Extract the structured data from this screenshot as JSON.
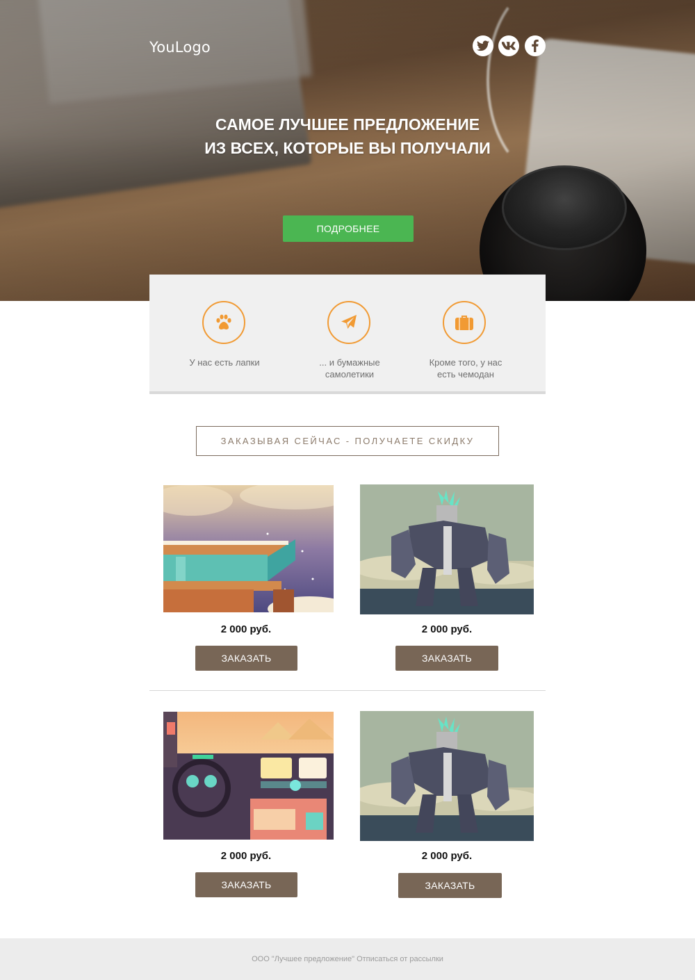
{
  "header": {
    "logo": "YouLogo",
    "social": [
      "twitter-icon",
      "vk-icon",
      "facebook-icon"
    ],
    "headline_line1": "САМОЕ ЛУЧШЕЕ ПРЕДЛОЖЕНИЕ",
    "headline_line2": "ИЗ ВСЕХ, КОТОРЫЕ ВЫ ПОЛУЧАЛИ",
    "cta_label": "ПОДРОБНЕЕ"
  },
  "features": [
    {
      "icon": "paw-icon",
      "line1": "У нас есть лапки",
      "line2": ""
    },
    {
      "icon": "paper-plane-icon",
      "line1": "... и бумажные",
      "line2": "самолетики"
    },
    {
      "icon": "suitcase-icon",
      "line1": "Кроме того, у нас",
      "line2": "есть чемодан"
    }
  ],
  "promo": "ЗАКАЗЫВАЯ СЕЙЧАС - ПОЛУЧАЕТЕ СКИДКУ",
  "products": [
    {
      "image": "house-illustration",
      "price": "2 000 руб.",
      "button": "ЗАКАЗАТЬ"
    },
    {
      "image": "robot-illustration",
      "price": "2 000 руб.",
      "button": "ЗАКАЗАТЬ"
    },
    {
      "image": "car-dashboard-illustration",
      "price": "2 000 руб.",
      "button": "ЗАКАЗАТЬ"
    },
    {
      "image": "robot-illustration",
      "price": "2 000 руб.",
      "button": "ЗАКАЗАТЬ"
    }
  ],
  "footer": {
    "text": "ООО \"Лучшее предложение\" Отписаться от рассылки"
  },
  "colors": {
    "accent_green": "#4bb652",
    "accent_orange": "#f19a33",
    "button_brown": "#786656",
    "feature_bg": "#f0f0f0",
    "footer_bg": "#ececec"
  }
}
